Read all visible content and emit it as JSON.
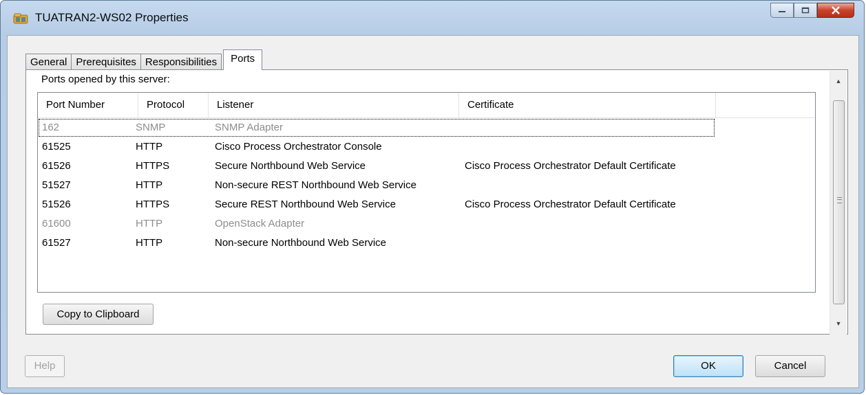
{
  "window": {
    "title": "TUATRAN2-WS02 Properties",
    "icon": "server-folder-icon"
  },
  "tabs": [
    {
      "label": "General",
      "active": false
    },
    {
      "label": "Prerequisites",
      "active": false
    },
    {
      "label": "Responsibilities",
      "active": false
    },
    {
      "label": "Ports",
      "active": true
    }
  ],
  "ports": {
    "label": "Ports opened by this server:",
    "columns": [
      "Port Number",
      "Protocol",
      "Listener",
      "Certificate"
    ],
    "rows": [
      {
        "port": "162",
        "protocol": "SNMP",
        "listener": "SNMP Adapter",
        "certificate": "",
        "enabled": false
      },
      {
        "port": "61525",
        "protocol": "HTTP",
        "listener": "Cisco Process Orchestrator Console",
        "certificate": "",
        "enabled": true
      },
      {
        "port": "61526",
        "protocol": "HTTPS",
        "listener": "Secure Northbound Web Service",
        "certificate": "Cisco Process Orchestrator Default Certificate",
        "enabled": true
      },
      {
        "port": "51527",
        "protocol": "HTTP",
        "listener": "Non-secure REST Northbound Web Service",
        "certificate": "",
        "enabled": true
      },
      {
        "port": "51526",
        "protocol": "HTTPS",
        "listener": "Secure REST Northbound Web Service",
        "certificate": "Cisco Process Orchestrator Default Certificate",
        "enabled": true
      },
      {
        "port": "61600",
        "protocol": "HTTP",
        "listener": "OpenStack Adapter",
        "certificate": "",
        "enabled": false
      },
      {
        "port": "61527",
        "protocol": "HTTP",
        "listener": "Non-secure Northbound Web Service",
        "certificate": "",
        "enabled": true
      }
    ],
    "copy_label": "Copy to Clipboard"
  },
  "buttons": {
    "help": "Help",
    "ok": "OK",
    "cancel": "Cancel"
  }
}
